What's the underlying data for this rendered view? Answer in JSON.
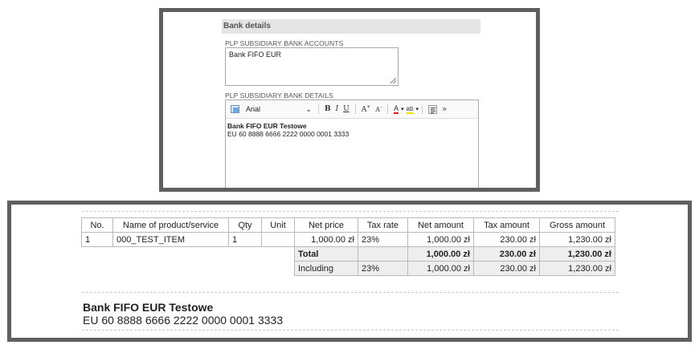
{
  "bank_form": {
    "section_title": "Bank details",
    "accounts_label": "PLP SUBSIDIARY BANK ACCOUNTS",
    "accounts_value": "Bank FIFO EUR",
    "details_label": "PLP SUBSIDIARY BANK DETAILS",
    "toolbar": {
      "font_value": "Arial",
      "bold": "B",
      "italic": "I",
      "underline": "U",
      "superscript": "A",
      "subscript": "A",
      "font_color": "A",
      "highlight": "ab",
      "more": "»"
    },
    "details_line1": "Bank FIFO EUR Testowe",
    "details_line2": "EU 60 8888 6666 2222 0000 0001 3333"
  },
  "invoice": {
    "columns": [
      "No.",
      "Name of product/service",
      "Qty",
      "Unit",
      "Net price",
      "Tax rate",
      "Net amount",
      "Tax amount",
      "Gross amount"
    ],
    "row": {
      "no": "1",
      "name": "000_TEST_ITEM",
      "qty": "1",
      "unit": "",
      "net_price": "1,000.00 zł",
      "tax_rate": "23%",
      "net_amount": "1,000.00 zł",
      "tax_amount": "230.00 zł",
      "gross_amount": "1,230.00 zł"
    },
    "total": {
      "label": "Total",
      "net_amount": "1,000.00 zł",
      "tax_amount": "230.00 zł",
      "gross_amount": "1,230.00 zł"
    },
    "including": {
      "label": "Including",
      "tax_rate": "23%",
      "net_amount": "1,000.00 zł",
      "tax_amount": "230.00 zł",
      "gross_amount": "1,230.00 zł"
    },
    "bank_title": "Bank FIFO EUR Testowe",
    "bank_number": "EU 60 8888 6666 2222 0000 0001 3333"
  }
}
